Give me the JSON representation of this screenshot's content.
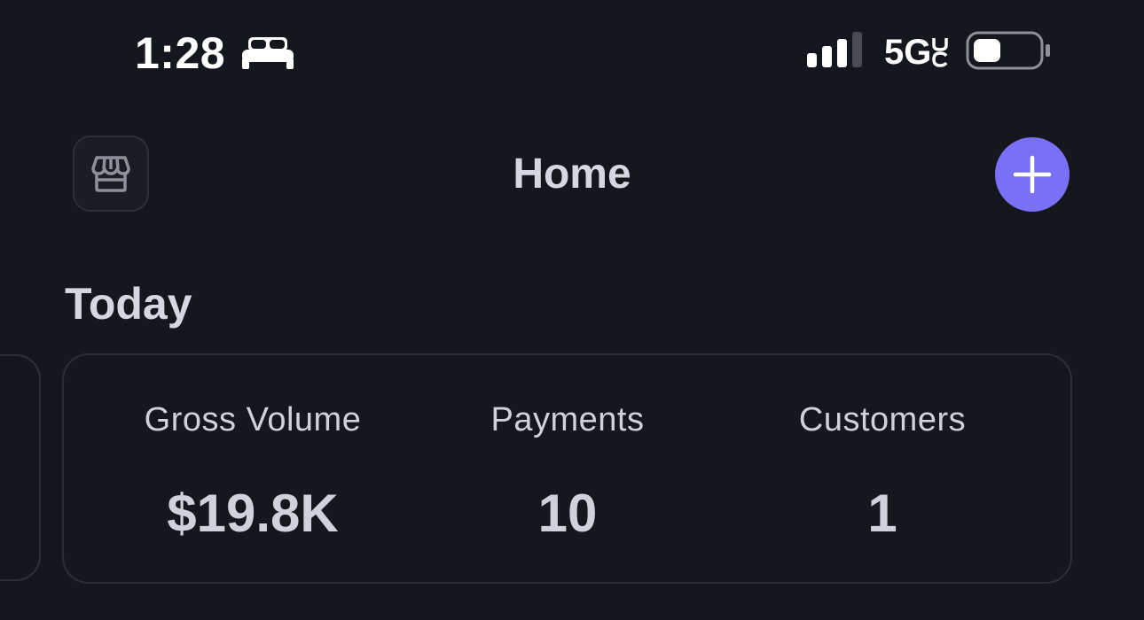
{
  "status_bar": {
    "time": "1:28",
    "network": "5G",
    "network_suffix": "UC",
    "sleep_icon": "bed-icon",
    "signal_icon": "cellular-signal-icon",
    "battery_icon": "battery-icon",
    "battery_level": 0.2
  },
  "header": {
    "title": "Home",
    "store_icon": "storefront-icon",
    "add_icon": "plus-icon"
  },
  "colors": {
    "background": "#15171e",
    "accent": "#7a70f5",
    "card_border": "#2c2f38",
    "text": "#d5d7e2"
  },
  "today": {
    "title": "Today",
    "stats": [
      {
        "label": "Gross Volume",
        "value": "$19.8K"
      },
      {
        "label": "Payments",
        "value": "10"
      },
      {
        "label": "Customers",
        "value": "1"
      }
    ]
  }
}
